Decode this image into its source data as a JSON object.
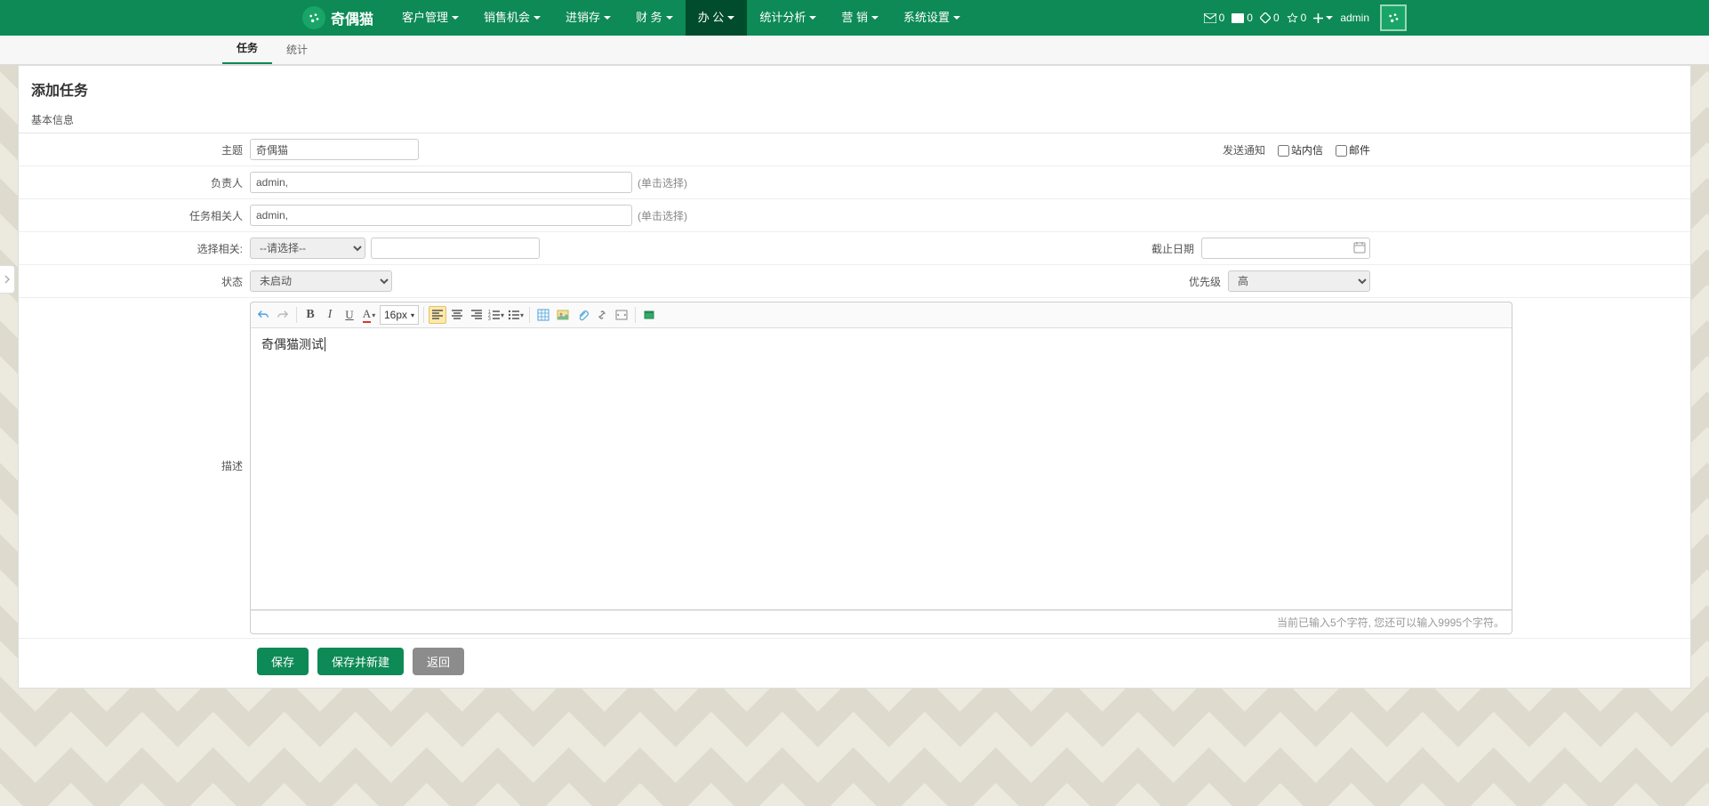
{
  "brand": "奇偶猫",
  "nav": [
    "客户管理",
    "销售机会",
    "进销存",
    "财 务",
    "办 公",
    "统计分析",
    "营 销",
    "系统设置"
  ],
  "navActive": 4,
  "right": {
    "mail": "0",
    "card": "0",
    "diamond": "0",
    "star": "0",
    "user": "admin"
  },
  "sub": {
    "tabs": [
      "任务",
      "统计"
    ],
    "active": 0
  },
  "title": "添加任务",
  "section": "基本信息",
  "labels": {
    "subject": "主题",
    "notify": "发送通知",
    "cbSite": "站内信",
    "cbMail": "邮件",
    "owner": "负责人",
    "ownerHint": "(单击选择)",
    "related": "任务相关人",
    "relatedHint": "(单击选择)",
    "relation": "选择相关:",
    "deadline": "截止日期",
    "status": "状态",
    "priority": "优先级",
    "desc": "描述"
  },
  "values": {
    "subject": "奇偶猫",
    "owner": "admin,",
    "related": "admin,",
    "relationSel": "--请选择--",
    "relationVal": "",
    "deadline": "",
    "status": "未启动",
    "priority": "高",
    "editor": "奇偶猫测试"
  },
  "editorFoot": "当前已输入5个字符, 您还可以输入9995个字符。",
  "btns": {
    "save": "保存",
    "saveNew": "保存并新建",
    "back": "返回"
  },
  "fontSize": "16px"
}
